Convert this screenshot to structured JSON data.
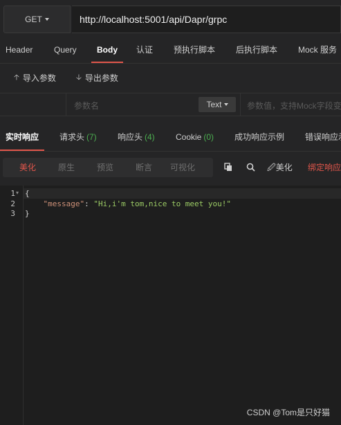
{
  "request": {
    "method": "GET",
    "url": "http://localhost:5001/api/Dapr/grpc"
  },
  "request_tabs": [
    "Header",
    "Query",
    "Body",
    "认证",
    "预执行脚本",
    "后执行脚本",
    "Mock 服务"
  ],
  "tools": {
    "import_label": "导入参数",
    "export_label": "导出参数"
  },
  "params": {
    "name_placeholder": "参数名",
    "type_value": "Text",
    "value_placeholder": "参数值，支持Mock字段变"
  },
  "response_tabs": {
    "realtime": "实时响应",
    "request_headers": "请求头",
    "request_headers_count": "(7)",
    "response_headers": "响应头",
    "response_headers_count": "(4)",
    "cookie": "Cookie",
    "cookie_count": "(0)",
    "success_example": "成功响应示例",
    "error_example": "错误响应示"
  },
  "view_modes": [
    "美化",
    "原生",
    "预览",
    "断言",
    "可视化"
  ],
  "view_tools": {
    "beautify_label": "美化",
    "bind_label": "绑定响应"
  },
  "editor": {
    "line_numbers": [
      "1",
      "2",
      "3"
    ],
    "open_brace": "{",
    "key": "\"message\"",
    "colon": ": ",
    "value": "\"Hi,i'm tom,nice to meet you!\"",
    "close_brace": "}"
  },
  "watermark": "CSDN @Tom是只好猫",
  "colors": {
    "accent": "#e2564b",
    "count_green": "#4caf50",
    "json_string": "#9ccc65",
    "json_key": "#ce9178"
  }
}
